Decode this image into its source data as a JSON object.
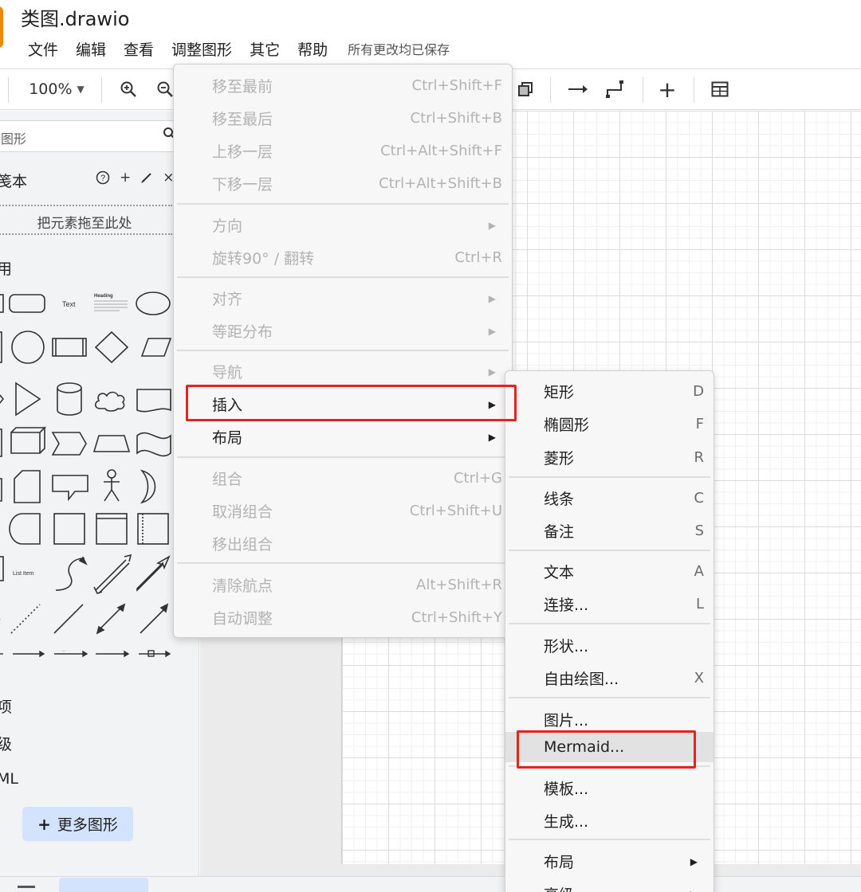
{
  "app": {
    "title": "类图.drawio"
  },
  "menubar": {
    "items": [
      "文件",
      "编辑",
      "查看",
      "调整图形",
      "其它",
      "帮助"
    ],
    "save_status": "所有更改均已保存"
  },
  "toolbar": {
    "zoom": "100%"
  },
  "sidebar": {
    "search_placeholder": "图形",
    "scratchpad_title": "笺本",
    "scratchpad_drop": "把元素拖至此处",
    "general_title": "用",
    "section_partial_1": "项",
    "section_partial_2": "级",
    "section_partial_3": "ML",
    "more_shapes": "更多图形",
    "shape_text_sample": "Text",
    "shape_heading_sample": "Heading",
    "shape_list_item_sample": "List Item"
  },
  "arrange_menu": {
    "items": [
      {
        "label": "移至最前",
        "shortcut": "Ctrl+Shift+F"
      },
      {
        "label": "移至最后",
        "shortcut": "Ctrl+Shift+B"
      },
      {
        "label": "上移一层",
        "shortcut": "Ctrl+Alt+Shift+F"
      },
      {
        "label": "下移一层",
        "shortcut": "Ctrl+Alt+Shift+B"
      },
      {
        "label": "方向",
        "shortcut": ""
      },
      {
        "label": "旋转90° / 翻转",
        "shortcut": "Ctrl+R"
      },
      {
        "label": "对齐",
        "shortcut": ""
      },
      {
        "label": "等距分布",
        "shortcut": ""
      },
      {
        "label": "导航",
        "shortcut": ""
      },
      {
        "label": "插入",
        "shortcut": ""
      },
      {
        "label": "布局",
        "shortcut": ""
      },
      {
        "label": "组合",
        "shortcut": "Ctrl+G"
      },
      {
        "label": "取消组合",
        "shortcut": "Ctrl+Shift+U"
      },
      {
        "label": "移出组合",
        "shortcut": ""
      },
      {
        "label": "清除航点",
        "shortcut": "Alt+Shift+R"
      },
      {
        "label": "自动调整",
        "shortcut": "Ctrl+Shift+Y"
      }
    ]
  },
  "insert_menu": {
    "items": [
      {
        "label": "矩形",
        "shortcut": "D"
      },
      {
        "label": "椭圆形",
        "shortcut": "F"
      },
      {
        "label": "菱形",
        "shortcut": "R"
      },
      {
        "label": "线条",
        "shortcut": "C"
      },
      {
        "label": "备注",
        "shortcut": "S"
      },
      {
        "label": "文本",
        "shortcut": "A"
      },
      {
        "label": "连接...",
        "shortcut": "L"
      },
      {
        "label": "形状...",
        "shortcut": ""
      },
      {
        "label": "自由绘图...",
        "shortcut": "X"
      },
      {
        "label": "图片...",
        "shortcut": ""
      },
      {
        "label": "Mermaid...",
        "shortcut": ""
      },
      {
        "label": "模板...",
        "shortcut": ""
      },
      {
        "label": "生成...",
        "shortcut": ""
      },
      {
        "label": "布局",
        "shortcut": ""
      },
      {
        "label": "高级",
        "shortcut": ""
      }
    ]
  },
  "colors": {
    "highlight": "#e3251b",
    "accent_button": "#d3e3fd",
    "app_icon": "#f08705"
  }
}
